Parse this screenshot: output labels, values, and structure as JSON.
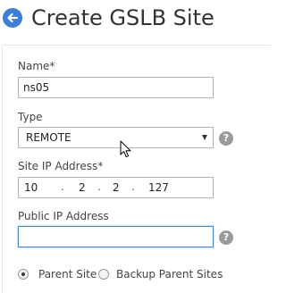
{
  "header": {
    "title": "Create GSLB Site"
  },
  "form": {
    "name": {
      "label": "Name*",
      "value": "ns05"
    },
    "type": {
      "label": "Type",
      "value": "REMOTE"
    },
    "site_ip": {
      "label": "Site IP Address*",
      "octets": [
        "10",
        "2",
        "2",
        "127"
      ]
    },
    "public_ip": {
      "label": "Public IP Address",
      "value": ""
    },
    "site_role": {
      "options": [
        "Parent Site",
        "Backup Parent Sites"
      ],
      "selected": "Parent Site"
    }
  },
  "help_glyph": "?",
  "ip_separator": ".",
  "colors": {
    "accent": "#3d7ed6",
    "focus_border": "#4d86c4",
    "help": "#9a9a9a"
  },
  "icons": {
    "back": "back-arrow-icon",
    "help": "help-icon",
    "cursor": "mouse-pointer-icon"
  }
}
